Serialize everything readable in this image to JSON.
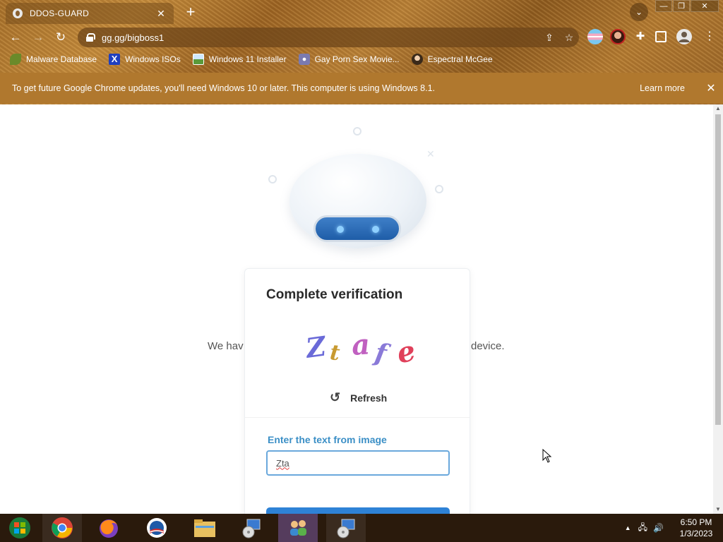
{
  "browser": {
    "tab_title": "DDOS-GUARD",
    "tab_close": "✕",
    "new_tab": "+",
    "url": "gg.gg/bigboss1",
    "window": {
      "minimize": "—",
      "restore": "❐",
      "close": "✕"
    }
  },
  "bookmarks": [
    {
      "label": "Malware Database",
      "icon": "leaf-icon",
      "color": "#6a8a2a"
    },
    {
      "label": "Windows ISOs",
      "icon": "x-logo-icon",
      "color": "#1f3fbf"
    },
    {
      "label": "Windows 11 Installer",
      "icon": "image-icon",
      "color": "#5a9a3a"
    },
    {
      "label": "Gay Porn Sex Movie...",
      "icon": "disc-icon",
      "color": "#7a7ab0"
    },
    {
      "label": "Espectral McGee",
      "icon": "character-icon",
      "color": "#3a2a1a"
    }
  ],
  "infobar": {
    "message": "To get future Google Chrome updates, you'll need Windows 10 or later. This computer is using Windows 8.1.",
    "learn_more": "Learn more",
    "close": "✕"
  },
  "page": {
    "background_text_left": "We hav",
    "background_text_right": "device."
  },
  "verification": {
    "title": "Complete verification",
    "captcha_text": "ZtaFe",
    "refresh_label": "Refresh",
    "input_label": "Enter the text from image",
    "input_value": "Zta",
    "accent": "#3b8fc6",
    "button_color": "#2e82d6"
  },
  "taskbar": {
    "time": "6:50 PM",
    "date": "1/3/2023"
  }
}
